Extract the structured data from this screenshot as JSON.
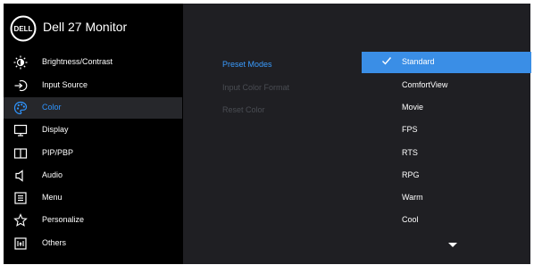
{
  "app": {
    "title": "Dell 27 Monitor",
    "logo_text": "DELL"
  },
  "sidebar": {
    "items": [
      {
        "label": "Brightness/Contrast",
        "icon": "brightness-icon",
        "active": false
      },
      {
        "label": "Input Source",
        "icon": "input-source-icon",
        "active": false
      },
      {
        "label": "Color",
        "icon": "color-palette-icon",
        "active": true
      },
      {
        "label": "Display",
        "icon": "display-icon",
        "active": false
      },
      {
        "label": "PIP/PBP",
        "icon": "pip-pbp-icon",
        "active": false
      },
      {
        "label": "Audio",
        "icon": "audio-icon",
        "active": false
      },
      {
        "label": "Menu",
        "icon": "menu-icon",
        "active": false
      },
      {
        "label": "Personalize",
        "icon": "star-icon",
        "active": false
      },
      {
        "label": "Others",
        "icon": "others-icon",
        "active": false
      }
    ]
  },
  "submenu": {
    "items": [
      {
        "label": "Preset Modes",
        "enabled": true
      },
      {
        "label": "Input Color Format",
        "enabled": false
      },
      {
        "label": "Reset Color",
        "enabled": false
      }
    ]
  },
  "options": {
    "items": [
      {
        "label": "Standard",
        "selected": true
      },
      {
        "label": "ComfortView",
        "selected": false
      },
      {
        "label": "Movie",
        "selected": false
      },
      {
        "label": "FPS",
        "selected": false
      },
      {
        "label": "RTS",
        "selected": false
      },
      {
        "label": "RPG",
        "selected": false
      },
      {
        "label": "Warm",
        "selected": false
      },
      {
        "label": "Cool",
        "selected": false
      }
    ],
    "more_indicator": "chevron-down-icon"
  },
  "colors": {
    "accent": "#3a8ee6",
    "active_label": "#2f95ff",
    "panel_bg": "#1f1f23",
    "sidebar_bg": "#000000",
    "disabled_text": "#4a4d53"
  }
}
